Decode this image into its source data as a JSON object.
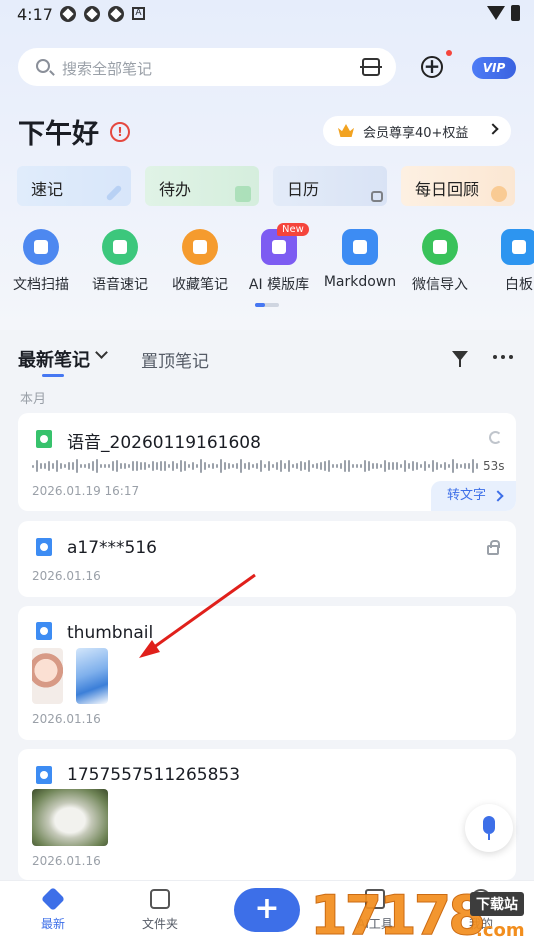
{
  "status_bar": {
    "time": "4:17",
    "a_label": "A"
  },
  "search": {
    "placeholder": "搜索全部笔记"
  },
  "header": {
    "vip_label": "VIP",
    "greeting": "下午好",
    "greeting_badge": "!",
    "vip_banner": "会员尊享40+权益"
  },
  "quick_cards": [
    {
      "label": "速记"
    },
    {
      "label": "待办"
    },
    {
      "label": "日历"
    },
    {
      "label": "每日回顾"
    }
  ],
  "tools": [
    {
      "label": "文档扫描",
      "icon": "scan-doc-icon"
    },
    {
      "label": "语音速记",
      "icon": "mic-icon"
    },
    {
      "label": "收藏笔记",
      "icon": "link-icon"
    },
    {
      "label": "AI 模版库",
      "icon": "ai-template-icon",
      "badge": "New"
    },
    {
      "label": "Markdown",
      "icon": "markdown-icon"
    },
    {
      "label": "微信导入",
      "icon": "wechat-icon"
    },
    {
      "label": "白板",
      "icon": "whiteboard-icon"
    }
  ],
  "tabs": {
    "latest": "最新笔记",
    "pinned": "置顶笔记"
  },
  "section_label": "本月",
  "notes": [
    {
      "type": "audio",
      "title": "语音_20260119161608",
      "date": "2026.01.19 16:17",
      "duration": "53s",
      "action": "转文字"
    },
    {
      "type": "image",
      "title": "a17***516",
      "date": "2026.01.16",
      "locked": true
    },
    {
      "type": "image",
      "title": "thumbnail",
      "date": "2026.01.16"
    },
    {
      "type": "image",
      "title": "1757557511265853",
      "date": "2026.01.16"
    }
  ],
  "bottom_nav": {
    "home": "最新",
    "folder": "文件夹",
    "add": "+",
    "ai": "AI工具",
    "me": "我的"
  },
  "watermark": {
    "digits": "17178",
    "tag": "下载站",
    "suffix": ".com"
  },
  "colors": {
    "accent": "#3d6fe8",
    "badge_red": "#f5453c",
    "watermark": "#f28e1e"
  }
}
